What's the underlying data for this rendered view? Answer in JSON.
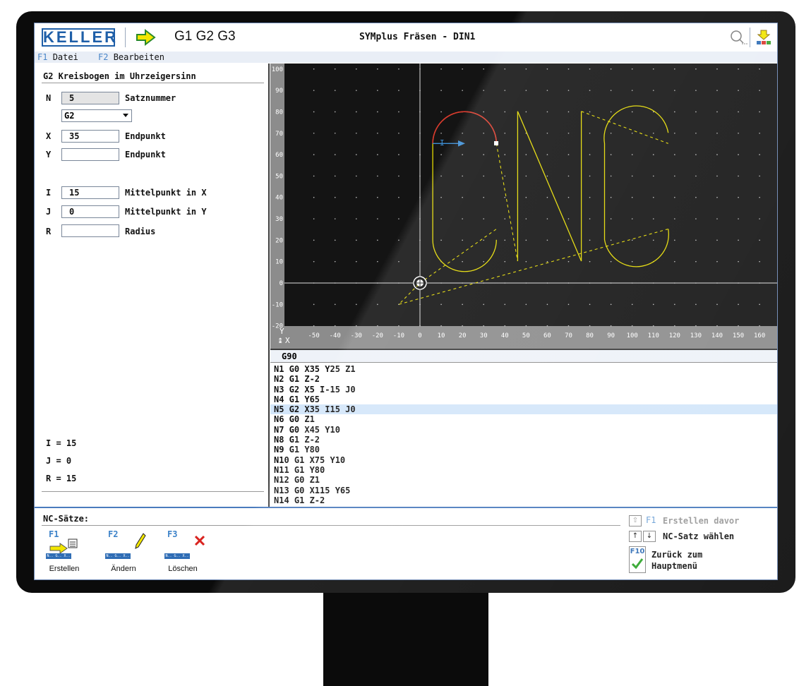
{
  "titlebar": {
    "logo": "KELLER",
    "mode": "G1 G2 G3",
    "app_title": "SYMplus Fräsen - DIN1"
  },
  "menubar": {
    "items": [
      {
        "key": "F1",
        "label": "Datei"
      },
      {
        "key": "F2",
        "label": "Bearbeiten"
      }
    ]
  },
  "left_panel": {
    "heading": "G2 Kreisbogen im Uhrzeigersinn",
    "fields": {
      "n": {
        "label": "N",
        "value": "5",
        "desc": "Satznummer"
      },
      "g": {
        "value": "G2"
      },
      "x": {
        "label": "X",
        "value": "35",
        "desc": "Endpunkt"
      },
      "y": {
        "label": "Y",
        "value": "",
        "desc": "Endpunkt"
      },
      "i": {
        "label": "I",
        "value": "15",
        "desc": "Mittelpunkt in X"
      },
      "j": {
        "label": "J",
        "value": "0",
        "desc": "Mittelpunkt in Y"
      },
      "r": {
        "label": "R",
        "value": "",
        "desc": "Radius"
      }
    },
    "results": [
      "I =  15",
      "J =  0",
      "R =  15"
    ]
  },
  "plot": {
    "x_ticks": [
      "-50",
      "-40",
      "-30",
      "-20",
      "-10",
      "0",
      "10",
      "20",
      "30",
      "40",
      "50",
      "60",
      "70",
      "80",
      "90",
      "100",
      "110",
      "120",
      "130",
      "140",
      "150",
      "160"
    ],
    "y_ticks": [
      "100",
      "90",
      "80",
      "70",
      "60",
      "50",
      "40",
      "30",
      "20",
      "10",
      "0",
      "-10",
      "-20"
    ],
    "axis_label_y": "Y",
    "axis_label_x": "X",
    "vector_label": "I",
    "colors": {
      "bg": "#141414",
      "path": "#e3d900",
      "arc": "#d9382f",
      "vector": "#3d8fd6"
    }
  },
  "code": {
    "header": "G90",
    "lines": [
      "N1 G0 X35 Y25 Z1",
      "N2 G1 Z-2",
      "N3 G2 X5 I-15 J0",
      "N4 G1 Y65",
      "N5 G2 X35 I15 J0",
      "N6 G0 Z1",
      "N7 G0 X45 Y10",
      "N8 G1 Z-2",
      "N9 G1 Y80",
      "N10 G1 X75 Y10",
      "N11 G1 Y80",
      "N12 G0 Z1",
      "N13 G0 X115 Y65",
      "N14 G1 Z-2"
    ],
    "selected_index": 4
  },
  "bottom": {
    "title": "NC-Sätze:",
    "softkeys": [
      {
        "key": "F1",
        "label": "Erstellen",
        "bar": "N.. G.. X.. Y.."
      },
      {
        "key": "F2",
        "label": "Ändern",
        "bar": "N.. G.. X.. Y.."
      },
      {
        "key": "F3",
        "label": "Löschen",
        "bar": "N.. G.. X.. Y.."
      }
    ],
    "right": {
      "create_before_key": "F1",
      "create_before": "Erstellen davor",
      "select": "NC-Satz wählen",
      "back_key": "F10",
      "back_line1": "Zurück zum",
      "back_line2": "Hauptmenü"
    }
  }
}
